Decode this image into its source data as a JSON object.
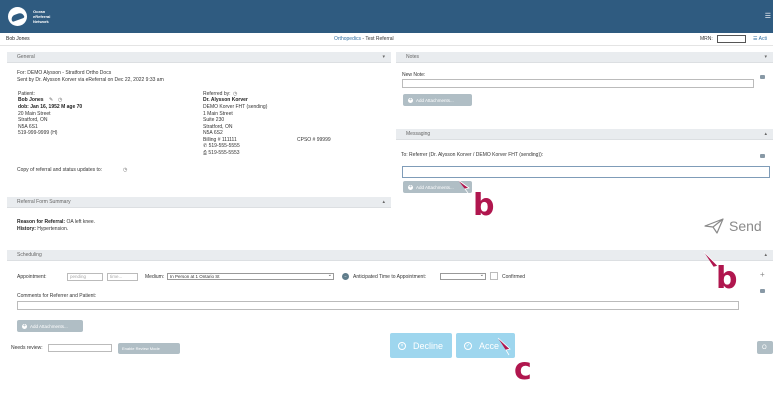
{
  "header": {
    "logo_line1": "Ocean",
    "logo_line2": "eReferral",
    "logo_line3": "Network",
    "menu_icon": "hamburger-icon"
  },
  "subheader": {
    "patient_name": "Bob Jones",
    "referral_service": "Orthopedics",
    "referral_rest": " - Test Referral",
    "mrn_label": "MRN:",
    "mrn_value": "",
    "actions_label": "Acti"
  },
  "general": {
    "title": "General",
    "for_line": "For: DEMO Alysson - Stratford Ortho Docs",
    "sent_line": "Sent by Dr. Alysson Korver via eReferral on Dec 22, 2022 9:33 am",
    "patient_label": "Patient:",
    "patient_name": "Bob Jones",
    "dob_line": "dob: Jan 16, 1952   M age 70",
    "address1": "20 Main Street",
    "address2": "Stratford, ON",
    "postal": "N5A 6S1",
    "phone": "519-999-9999 (H)",
    "referred_by_label": "Referred by:",
    "ref_name": "Dr. Alysson Korver",
    "ref_clinic": "DEMO Korver FHT (sending)",
    "ref_addr1": "1 Main Street",
    "ref_addr2": "Suite 230",
    "ref_addr3": "Stratford, ON",
    "ref_postal": "N5A 6S2",
    "billing": "Billing # 111111",
    "cpso": "CPSO # 99999",
    "ref_phone": "519-555-5555",
    "ref_fax": "519-555-5553",
    "copy_line": "Copy of referral and status updates to:"
  },
  "notes": {
    "title": "Notes",
    "new_note_label": "New Note:",
    "new_note_value": "",
    "add_attachments": "Add Attachments..."
  },
  "messaging": {
    "title": "Messaging",
    "to_line": "To: Referrer (Dr. Alysson Korver / DEMO Korver FHT (sending)):",
    "message_value": "",
    "add_attachments": "Add Attachments...",
    "send_label": "Send"
  },
  "summary": {
    "title": "Referral Form Summary",
    "reason_label": "Reason for Referral:",
    "reason_value": " OA left knee.",
    "history_label": "History:",
    "history_value": " Hypertension."
  },
  "scheduling": {
    "title": "Scheduling",
    "appointment_label": "Appointment:",
    "date_placeholder": "pending",
    "time_placeholder": "time...",
    "medium_label": "Medium:",
    "medium_value": "In Person at 1 Ontario St",
    "anticipated_label": "Anticipated Time to Appointment:",
    "anticipated_value": "",
    "confirmed_label": "Confirmed",
    "comments_label": "Comments for Referrer and Patient:",
    "comments_value": "",
    "add_attachments": "Add Attachments...",
    "needs_review_label": "Needs review:",
    "needs_review_value": "",
    "review_mode_button": "Enable Review Mode"
  },
  "footer": {
    "decline_label": "Decline",
    "accept_label": "Acce",
    "right_stub": "O"
  },
  "annotations": {
    "badge_b1": "b",
    "badge_b2": "b",
    "badge_c": "c",
    "badge_color": "#b0164e"
  },
  "colors": {
    "header_bg": "#2f5b80",
    "panel_head_bg": "#e9ecef",
    "button_blue": "#9ed6ee",
    "button_grey": "#b0bec5",
    "link_blue": "#2f6fa3"
  }
}
